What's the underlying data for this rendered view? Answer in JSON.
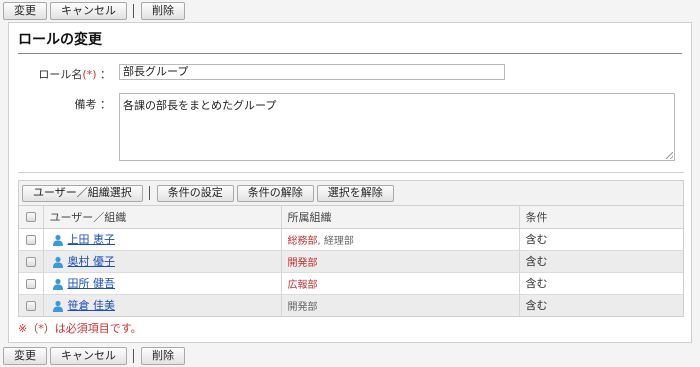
{
  "toolbar": {
    "change_label": "変更",
    "cancel_label": "キャンセル",
    "delete_label": "削除"
  },
  "form": {
    "title": "ロールの変更",
    "name_label": "ロール名",
    "required_mark": "(*)",
    "colon": "：",
    "name_value": "部長グループ",
    "note_label": "備考",
    "note_value": "各課の部長をまとめたグループ"
  },
  "members": {
    "toolbar": {
      "select_label": "ユーザー／組織選択",
      "condition_set_label": "条件の設定",
      "condition_clear_label": "条件の解除",
      "deselect_label": "選択を解除"
    },
    "columns": [
      "ユーザー／組織",
      "所属組織",
      "条件"
    ],
    "rows": [
      {
        "name": "上田 恵子",
        "org_main": "総務部",
        "org_extra": ", 経理部",
        "org_color": "red",
        "condition": "含む"
      },
      {
        "name": "奥村 優子",
        "org_main": "開発部",
        "org_extra": "",
        "org_color": "red",
        "condition": "含む"
      },
      {
        "name": "田所 健吾",
        "org_main": "広報部",
        "org_extra": "",
        "org_color": "red",
        "condition": "含む"
      },
      {
        "name": "笹倉 佳美",
        "org_main": "開発部",
        "org_extra": "",
        "org_color": "gray",
        "condition": "含む"
      }
    ]
  },
  "footnote": "※（*）は必須項目です。",
  "colors": {
    "required": "#d03030",
    "link": "#1a4fb5",
    "user_icon": "#3a9ad9"
  },
  "icons": {
    "user": "user-icon"
  }
}
